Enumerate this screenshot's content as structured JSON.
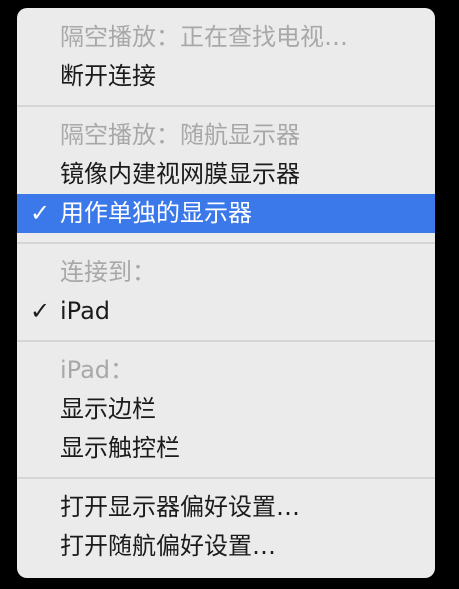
{
  "menu": {
    "sections": [
      {
        "items": [
          {
            "label": "隔空播放：正在查找电视…",
            "enabled": false,
            "checked": false
          },
          {
            "label": "断开连接",
            "enabled": true,
            "checked": false
          }
        ]
      },
      {
        "items": [
          {
            "label": "隔空播放：随航显示器",
            "enabled": false,
            "checked": false
          },
          {
            "label": "镜像内建视网膜显示器",
            "enabled": true,
            "checked": false
          },
          {
            "label": "用作单独的显示器",
            "enabled": true,
            "checked": true,
            "highlighted": true
          }
        ]
      },
      {
        "items": [
          {
            "label": "连接到：",
            "enabled": false,
            "checked": false
          },
          {
            "label": "iPad",
            "enabled": true,
            "checked": true
          }
        ]
      },
      {
        "items": [
          {
            "label": "iPad：",
            "enabled": false,
            "checked": false
          },
          {
            "label": "显示边栏",
            "enabled": true,
            "checked": false
          },
          {
            "label": "显示触控栏",
            "enabled": true,
            "checked": false
          }
        ]
      },
      {
        "items": [
          {
            "label": "打开显示器偏好设置…",
            "enabled": true,
            "checked": false
          },
          {
            "label": "打开随航偏好设置…",
            "enabled": true,
            "checked": false
          }
        ]
      }
    ],
    "check_glyph": "✓",
    "colors": {
      "background": "#ebebeb",
      "highlight": "#3b78ea",
      "disabled_text": "#a8a8a8",
      "text": "#1b1b1b"
    }
  }
}
